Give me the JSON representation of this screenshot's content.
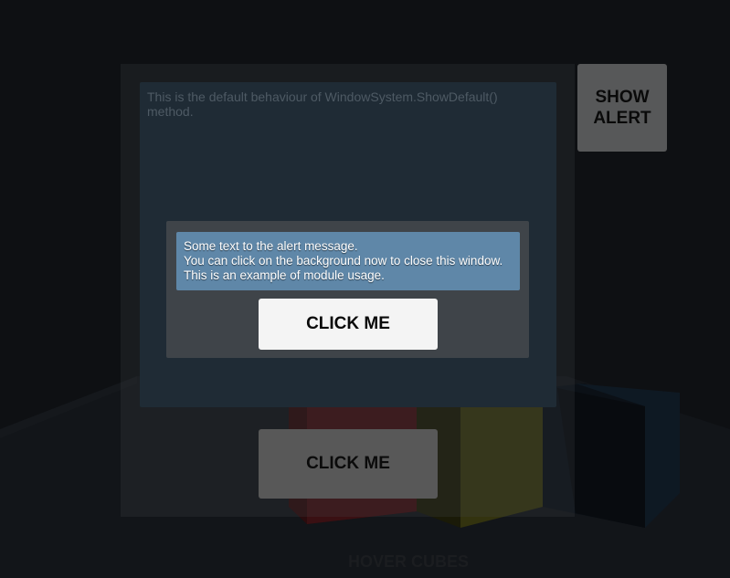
{
  "main_window": {
    "description_text": "This is the default behaviour of WindowSystem.ShowDefault() method.",
    "show_alert_label": "SHOW\nALERT",
    "click_me_label": "CLICK ME"
  },
  "alert": {
    "message": "Some text to the alert message.\nYou can click on the background now to close this window. This is an example of module usage.",
    "click_me_label": "CLICK ME"
  },
  "scene": {
    "hover_label": "HOVER CUBES",
    "cube_colors": [
      "#3a0f12",
      "#3a3a10",
      "#0f1a24"
    ]
  },
  "colors": {
    "alert_message_bg": "#5f87a8",
    "alert_window_bg": "#3f4449",
    "panel_bg": "#1f2b35"
  }
}
